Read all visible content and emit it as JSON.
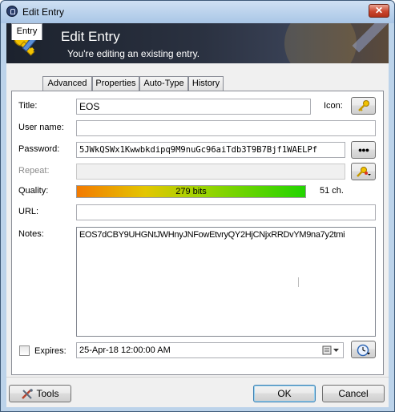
{
  "window": {
    "title": "Edit Entry",
    "close_label": "✕"
  },
  "banner": {
    "title": "Edit Entry",
    "subtitle": "You're editing an existing entry."
  },
  "tabs": [
    {
      "label": "Entry",
      "active": true
    },
    {
      "label": "Advanced",
      "active": false
    },
    {
      "label": "Properties",
      "active": false
    },
    {
      "label": "Auto-Type",
      "active": false
    },
    {
      "label": "History",
      "active": false
    }
  ],
  "form": {
    "title_label": "Title:",
    "title_value": "EOS",
    "icon_label": "Icon:",
    "username_label": "User name:",
    "username_value": "",
    "password_label": "Password:",
    "password_value": "5JWkQSWx1Kwwbkdipq9M9nuGc96aiTdb3T9B7Bjf1WAELPf",
    "reveal_label": "●●●",
    "repeat_label": "Repeat:",
    "repeat_value": "",
    "quality_label": "Quality:",
    "quality_text": "279 bits",
    "quality_fraction": 1.0,
    "length_text": "51 ch.",
    "url_label": "URL:",
    "url_value": "",
    "notes_label": "Notes:",
    "notes_value": "EOS7dCBY9UHGNtJWHnyJNFowEtvryQY2HjCNjxRRDvYM9na7y2tmi",
    "expires_label": "Expires:",
    "expires_checked": false,
    "expires_value": "25-Apr-18 12:00:00 AM"
  },
  "footer": {
    "tools_label": "Tools",
    "ok_label": "OK",
    "cancel_label": "Cancel"
  },
  "colors": {
    "banner_bg": "#1c222d",
    "quality_start": "#f37a00",
    "quality_end": "#22d400",
    "key_icon": "#f2c200"
  }
}
